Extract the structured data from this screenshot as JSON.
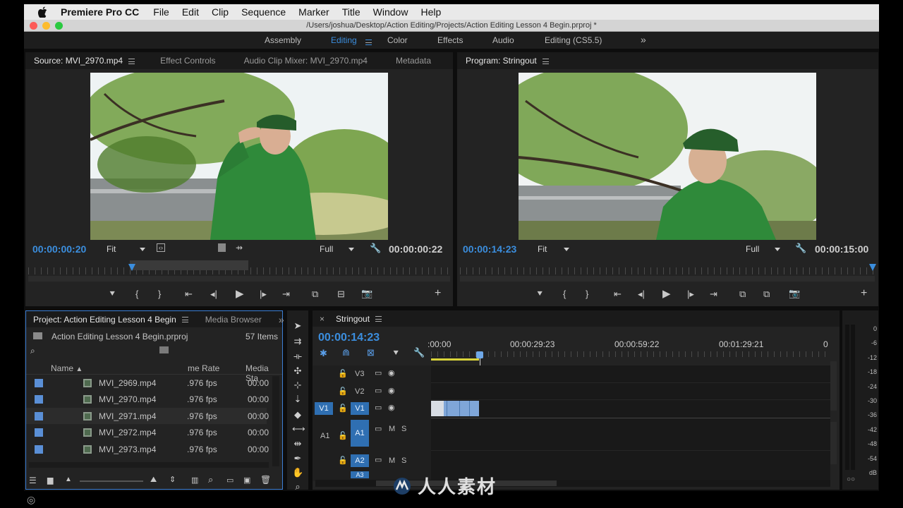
{
  "menubar": {
    "app_name": "Premiere Pro CC",
    "items": [
      "File",
      "Edit",
      "Clip",
      "Sequence",
      "Marker",
      "Title",
      "Window",
      "Help"
    ]
  },
  "window": {
    "title": "/Users/joshua/Desktop/Action Editing/Projects/Action Editing Lesson 4 Begin.prproj *"
  },
  "workspaces": {
    "items": [
      "Assembly",
      "Editing",
      "Color",
      "Effects",
      "Audio",
      "Editing (CS5.5)"
    ],
    "active": "Editing",
    "overflow": "»"
  },
  "source": {
    "tabs": [
      "Source: MVI_2970.mp4",
      "Effect Controls",
      "Audio Clip Mixer: MVI_2970.mp4",
      "Metadata"
    ],
    "timecode_in": "00:00:00:20",
    "fit": "Fit",
    "quality": "Full",
    "duration": "00:00:00:22"
  },
  "program": {
    "tab": "Program: Stringout",
    "timecode": "00:00:14:23",
    "fit": "Fit",
    "quality": "Full",
    "duration": "00:00:15:00"
  },
  "project": {
    "tabs": [
      "Project: Action Editing Lesson 4 Begin",
      "Media Browser"
    ],
    "overflow": "»",
    "file_name": "Action Editing Lesson 4 Begin.prproj",
    "item_count": "57 Items",
    "columns": [
      "Name",
      "me Rate",
      "Media Sta"
    ],
    "rows": [
      {
        "name": "MVI_2969.mp4",
        "rate": ".976 fps",
        "start": "00:00"
      },
      {
        "name": "MVI_2970.mp4",
        "rate": ".976 fps",
        "start": "00:00"
      },
      {
        "name": "MVI_2971.mp4",
        "rate": ".976 fps",
        "start": "00:00"
      },
      {
        "name": "MVI_2972.mp4",
        "rate": ".976 fps",
        "start": "00:00"
      },
      {
        "name": "MVI_2973.mp4",
        "rate": ".976 fps",
        "start": "00:00"
      }
    ]
  },
  "timeline": {
    "tab": "Stringout",
    "close": "×",
    "timecode": "00:00:14:23",
    "ruler_labels": [
      ":00:00",
      "00:00:29:23",
      "00:00:59:22",
      "00:01:29:21",
      "0"
    ],
    "video_tracks": [
      "V3",
      "V2",
      "V1"
    ],
    "audio_tracks": [
      "A1",
      "A2",
      "A3"
    ],
    "source_v": "V1",
    "source_a": "A1",
    "mute": "M",
    "solo": "S"
  },
  "meter": {
    "labels": [
      "0",
      "-6",
      "-12",
      "-18",
      "-24",
      "-30",
      "-36",
      "-42",
      "-48",
      "-54",
      "dB"
    ]
  },
  "watermark": {
    "text": "人人素材"
  },
  "colors": {
    "accent": "#3b8ede",
    "track_on": "#2f6fb2",
    "clip": "#7fa6d8",
    "playhead": "#6fa8e8"
  }
}
